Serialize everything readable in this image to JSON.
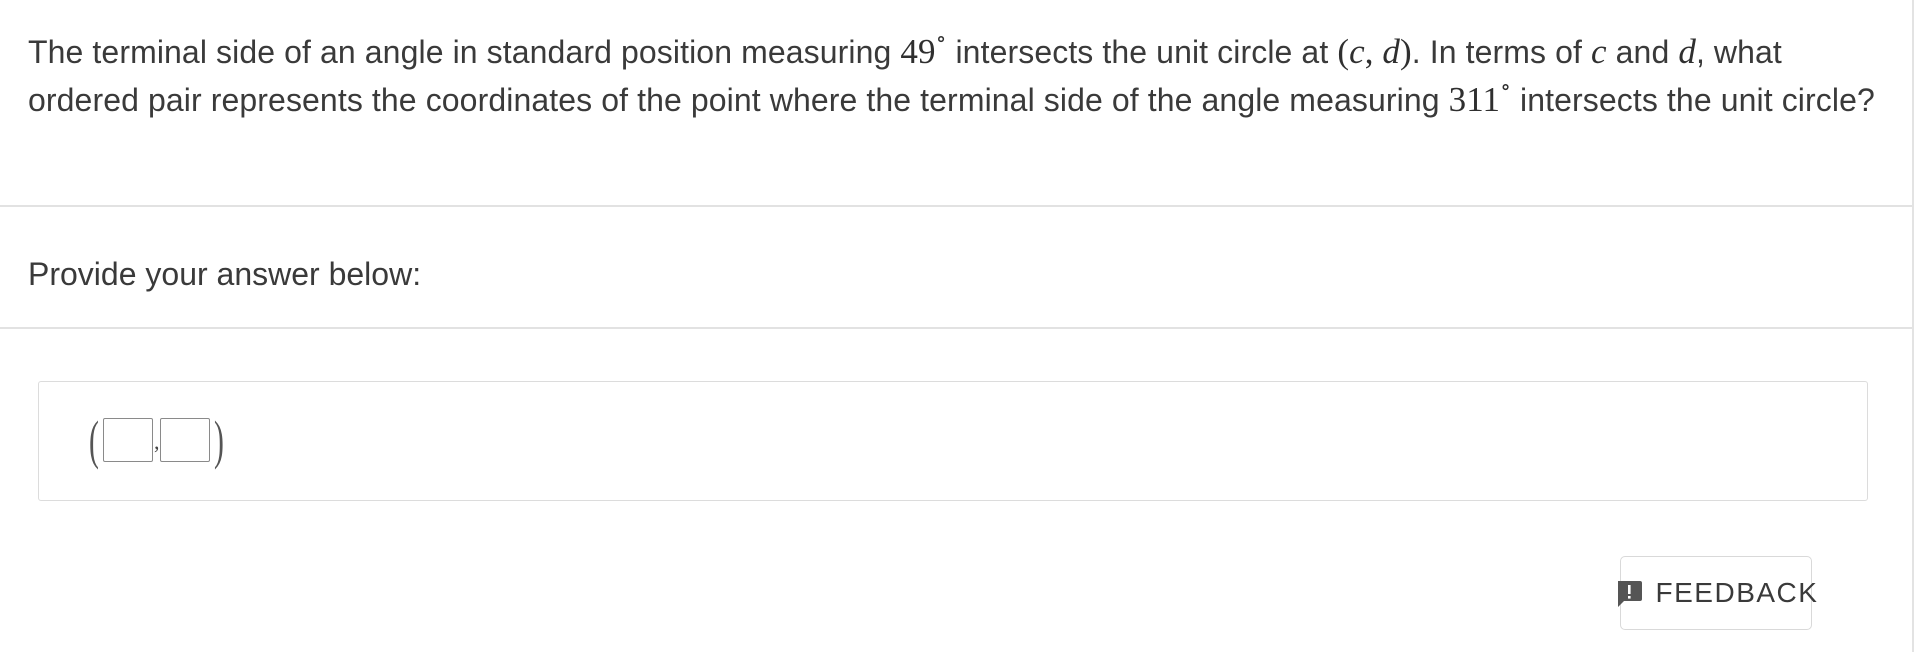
{
  "question": {
    "part1": "The terminal side of an angle in standard position measuring ",
    "angle1": "49",
    "degree_symbol": "∘",
    "part2": " intersects the unit circle at ",
    "point_open": "(",
    "var_c": "c",
    "point_sep": ", ",
    "var_d": "d",
    "point_close": ")",
    "part3": ". In terms of ",
    "part4": " and ",
    "part5": ", what ordered pair represents the coordinates of the point where the terminal side of the angle measuring ",
    "angle2": "311",
    "part6": " intersects the unit circle?"
  },
  "prompt": "Provide your answer below:",
  "answer": {
    "open_paren": "(",
    "separator": ",",
    "close_paren": ")",
    "first_value": "",
    "second_value": ""
  },
  "feedback": {
    "label": "FEEDBACK",
    "icon": "feedback-exclamation-icon"
  },
  "colors": {
    "text": "#3a3a3a",
    "divider": "#e2e2e2",
    "border": "#dcdcdc",
    "icon": "#555555"
  }
}
